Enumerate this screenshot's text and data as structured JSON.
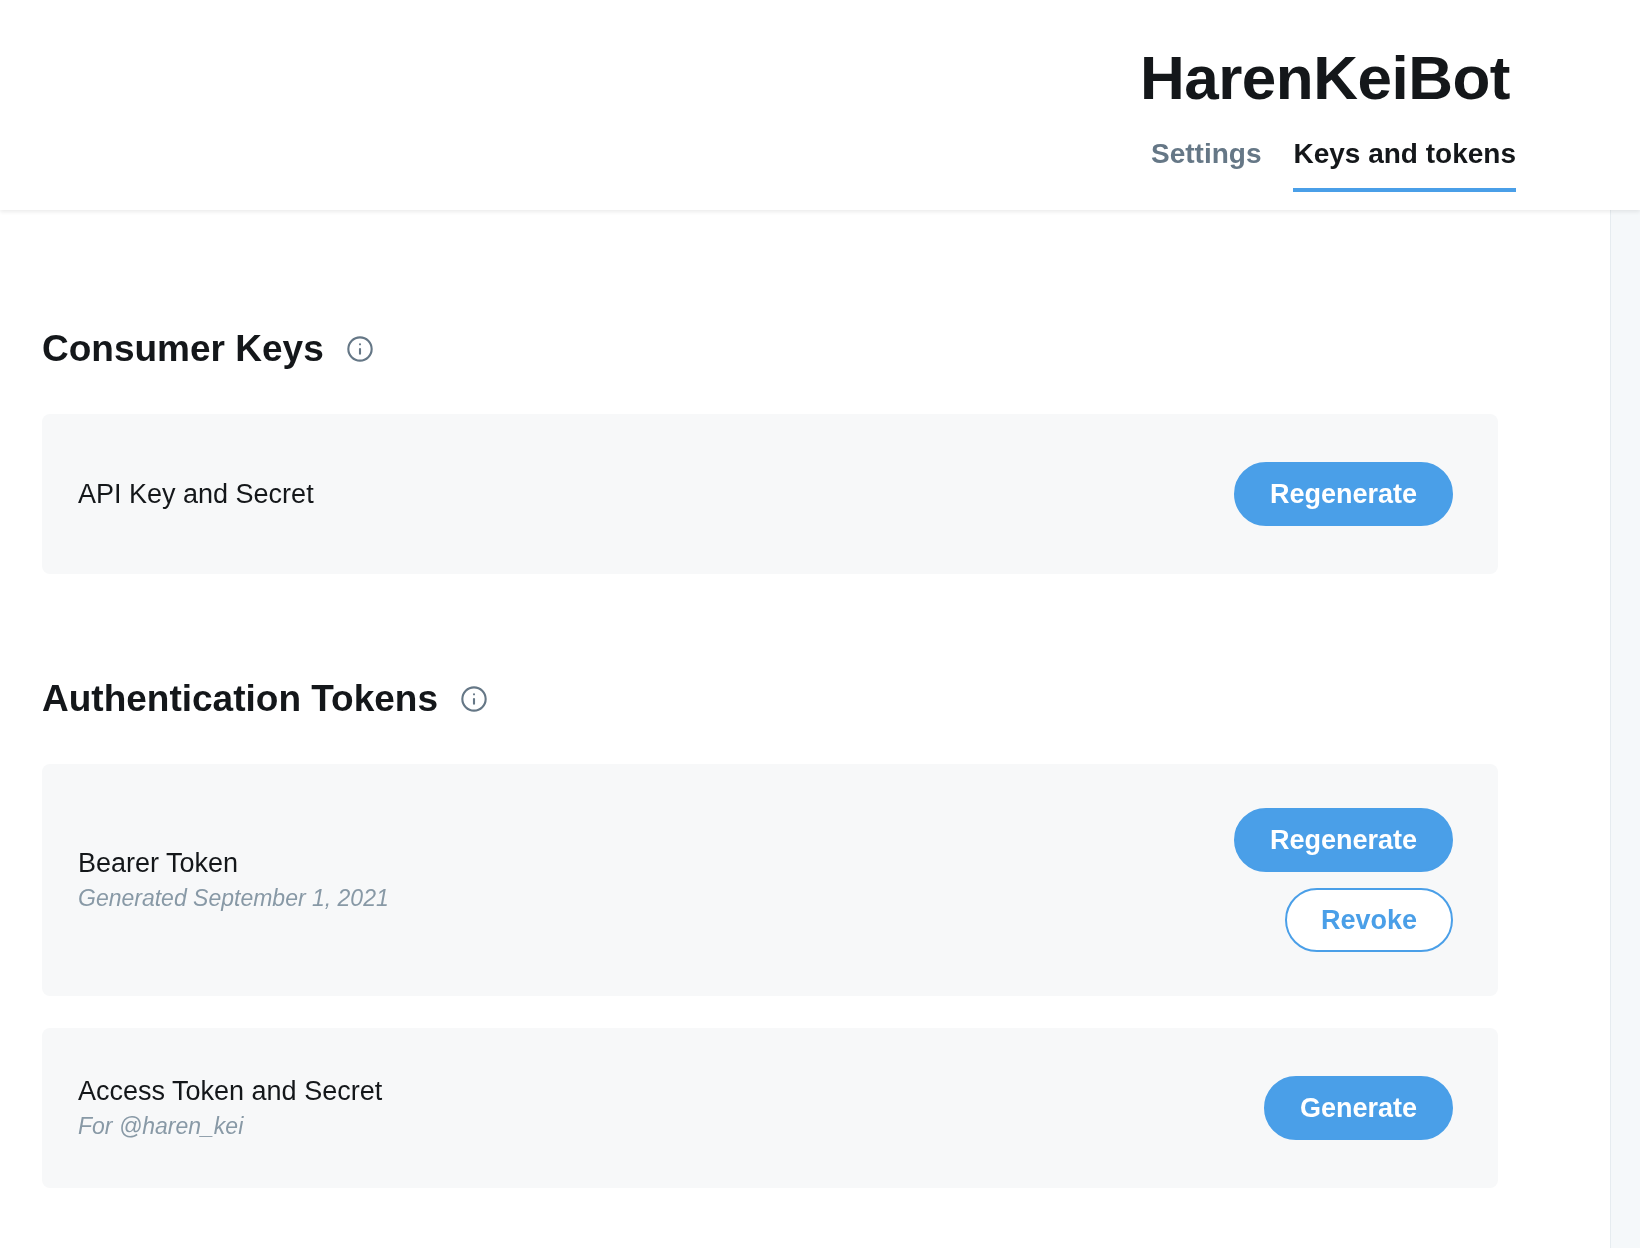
{
  "app": {
    "title": "HarenKeiBot"
  },
  "tabs": [
    {
      "label": "Settings",
      "selected": false
    },
    {
      "label": "Keys and tokens",
      "selected": true
    }
  ],
  "sections": [
    {
      "title": "Consumer Keys",
      "cards": [
        {
          "label": "API Key and Secret",
          "buttons": [
            {
              "label": "Regenerate",
              "kind": "primary"
            }
          ]
        }
      ]
    },
    {
      "title": "Authentication Tokens",
      "cards": [
        {
          "label": "Bearer Token",
          "subtitle": "Generated September 1, 2021",
          "buttons": [
            {
              "label": "Regenerate",
              "kind": "primary"
            },
            {
              "label": "Revoke",
              "kind": "outline"
            }
          ]
        },
        {
          "label": "Access Token and Secret",
          "subtitle": "For @haren_kei",
          "buttons": [
            {
              "label": "Generate",
              "kind": "primary"
            }
          ]
        }
      ]
    }
  ]
}
